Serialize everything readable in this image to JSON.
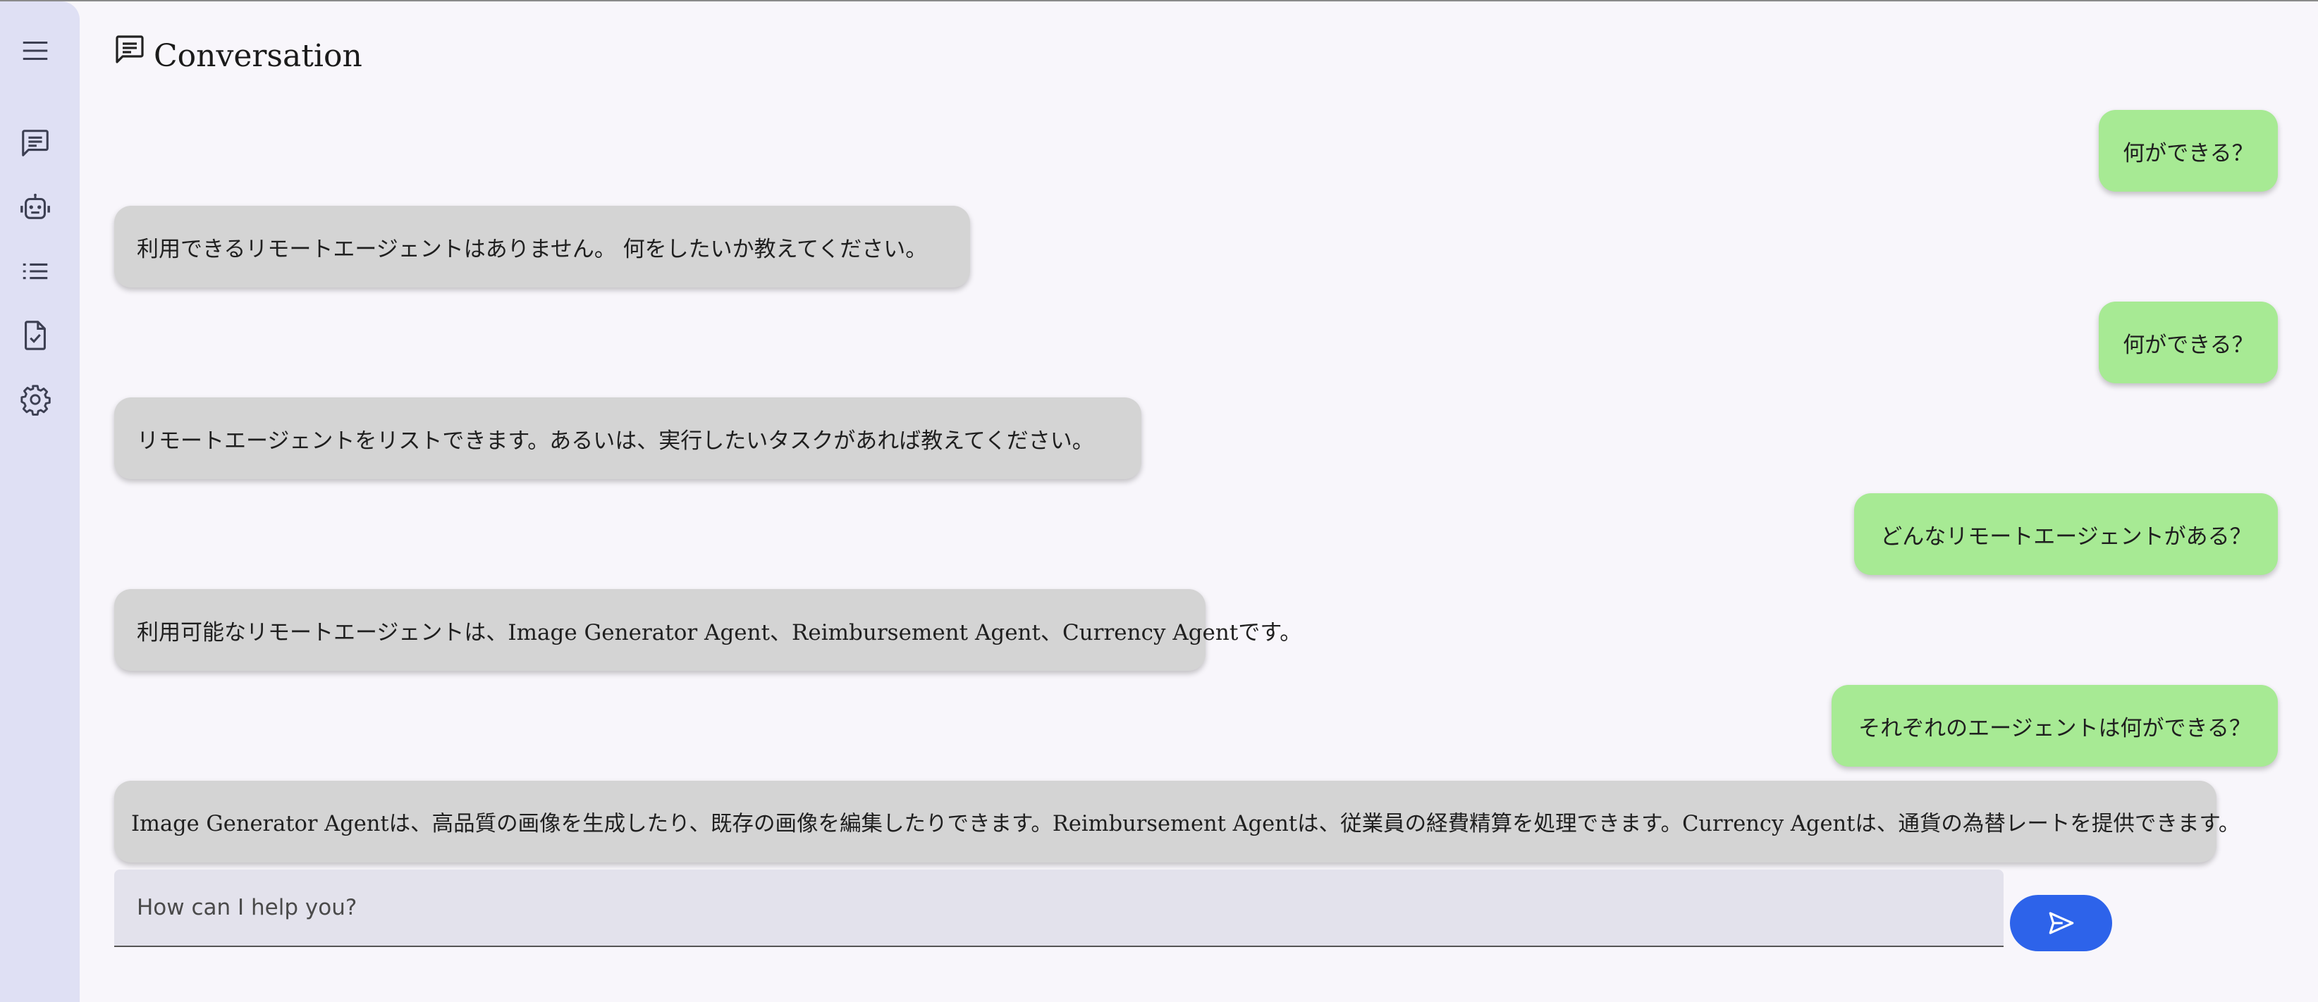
{
  "header": {
    "title": "Conversation",
    "icon": "chat-icon"
  },
  "nav_rail": {
    "items": [
      {
        "name": "menu",
        "icon": "menu-icon"
      },
      {
        "name": "conversations",
        "icon": "chat-icon"
      },
      {
        "name": "agents",
        "icon": "robot-icon"
      },
      {
        "name": "event-list",
        "icon": "list-icon"
      },
      {
        "name": "tasks",
        "icon": "task-icon"
      },
      {
        "name": "settings",
        "icon": "gear-icon"
      }
    ]
  },
  "messages": [
    {
      "role": "user",
      "text": "何ができる？"
    },
    {
      "role": "agent",
      "text": "利用できるリモートエージェントはありません。 何をしたいか教えてください。"
    },
    {
      "role": "user",
      "text": "何ができる？"
    },
    {
      "role": "agent",
      "text": "リモートエージェントをリストできます。あるいは、実行したいタスクがあれば教えてください。"
    },
    {
      "role": "user",
      "text": "どんなリモートエージェントがある？"
    },
    {
      "role": "agent",
      "text": "利用可能なリモートエージェントは、Image Generator Agent、Reimbursement Agent、Currency Agentです。"
    },
    {
      "role": "user",
      "text": "それぞれのエージェントは何ができる？"
    },
    {
      "role": "agent",
      "text": "Image Generator Agentは、高品質の画像を生成したり、既存の画像を編集したりできます。Reimbursement Agentは、従業員の経費精算を処理できます。Currency Agentは、通貨の為替レートを提供できます。"
    }
  ],
  "composer": {
    "placeholder": "How can I help you?",
    "value": "",
    "send_icon": "send-icon"
  },
  "colors": {
    "background": "#f8f6fb",
    "rail": "#dfe0f4",
    "user_bubble": "#a7ea94",
    "agent_bubble": "#d4d4d4",
    "input": "#e3e2ec",
    "send_button": "#2d63ea"
  }
}
